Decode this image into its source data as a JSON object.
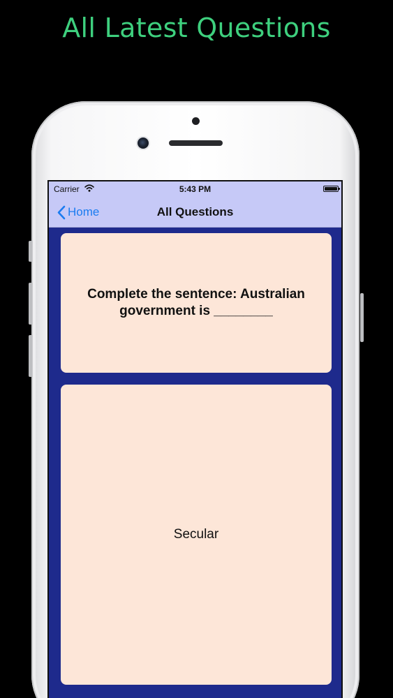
{
  "promo": {
    "title": "All Latest Questions"
  },
  "status_bar": {
    "carrier": "Carrier",
    "time": "5:43 PM",
    "icons": [
      "wifi-icon",
      "battery-icon"
    ]
  },
  "nav": {
    "back_label": "Home",
    "back_icon": "chevron-left-icon",
    "title": "All Questions"
  },
  "question": {
    "text": "Complete the sentence: Australian government is ________"
  },
  "answer": {
    "text": "Secular"
  },
  "colors": {
    "promo_text": "#3ed07e",
    "nav_background": "#c6c9f7",
    "screen_background": "#1e2a8c",
    "card_background": "#fde6d8",
    "link_blue": "#1b7cf0"
  }
}
